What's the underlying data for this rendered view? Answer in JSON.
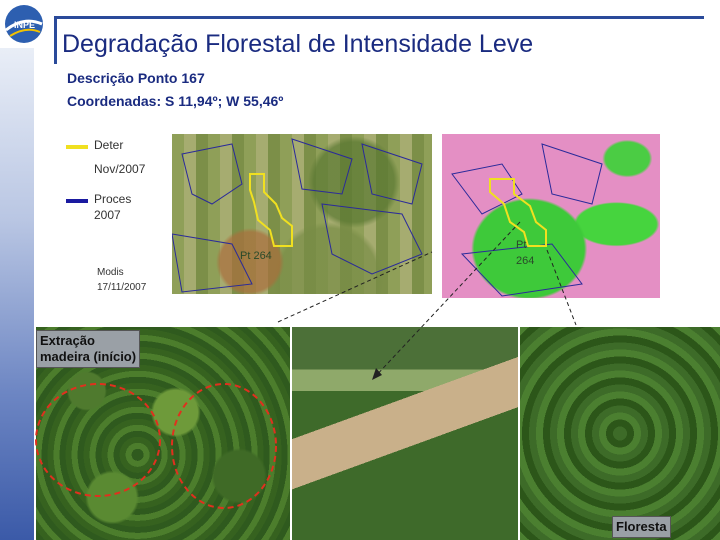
{
  "header": {
    "title": "Degradação Florestal de Intensidade Leve",
    "logo_text": "INPE"
  },
  "description": {
    "line1": "Descrição Ponto 167",
    "line2": "Coordenadas: S 11,94º; W 55,46º"
  },
  "legend": {
    "deter_label": "Deter",
    "deter_date": "Nov/2007",
    "deter_color": "#f0e020",
    "proces_label": "Proces",
    "proces_date": "2007",
    "proces_color": "#1a1aa0",
    "modis_label": "Modis",
    "modis_date": "17/11/2007"
  },
  "images": {
    "left_point": "Pt 264",
    "right_point_line1": "Pt",
    "right_point_line2": "264"
  },
  "photos": {
    "left_label_line1": "Extração",
    "left_label_line2": "madeira (início)",
    "right_label": "Floresta"
  },
  "colors": {
    "title": "#1a2b80",
    "accent_line": "#2a4a9a",
    "circle": "#e0301e"
  }
}
